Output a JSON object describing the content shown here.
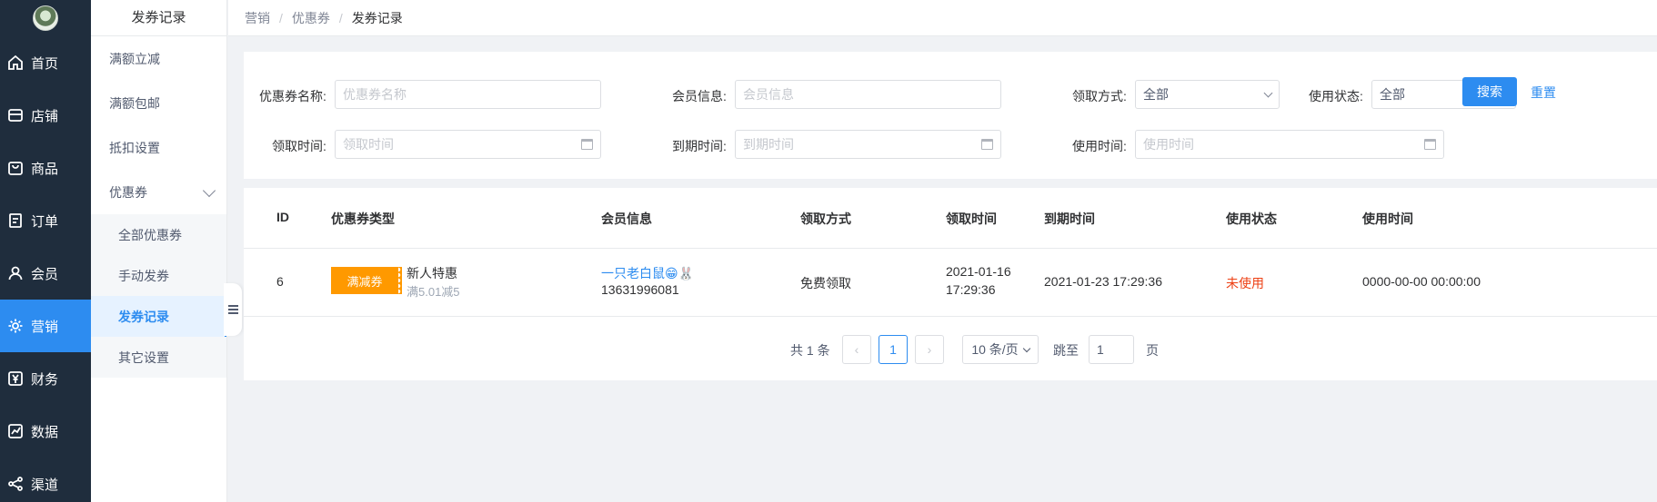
{
  "nav": {
    "items": [
      {
        "label": "首页",
        "icon": "home-icon"
      },
      {
        "label": "店铺",
        "icon": "store-icon"
      },
      {
        "label": "商品",
        "icon": "bag-icon"
      },
      {
        "label": "订单",
        "icon": "order-icon"
      },
      {
        "label": "会员",
        "icon": "user-icon"
      },
      {
        "label": "营销",
        "icon": "gear-icon"
      },
      {
        "label": "财务",
        "icon": "yen-icon"
      },
      {
        "label": "数据",
        "icon": "chart-icon"
      },
      {
        "label": "渠道",
        "icon": "share-icon"
      }
    ]
  },
  "subnav": {
    "title": "发券记录",
    "items": [
      "满额立减",
      "满额包邮",
      "抵扣设置",
      "优惠券"
    ],
    "children": [
      "全部优惠券",
      "手动发券",
      "发券记录",
      "其它设置"
    ]
  },
  "breadcrumb": [
    "营销",
    "优惠券",
    "发券记录"
  ],
  "filters": {
    "coupon_name_label": "优惠券名称:",
    "coupon_name_placeholder": "优惠券名称",
    "member_label": "会员信息:",
    "member_placeholder": "会员信息",
    "method_label": "领取方式:",
    "method_value": "全部",
    "status_label": "使用状态:",
    "status_value": "全部",
    "receive_time_label": "领取时间:",
    "receive_time_placeholder": "领取时间",
    "expire_time_label": "到期时间:",
    "expire_time_placeholder": "到期时间",
    "use_time_label": "使用时间:",
    "use_time_placeholder": "使用时间",
    "search_label": "搜索",
    "reset_label": "重置"
  },
  "table": {
    "columns": [
      "ID",
      "优惠券类型",
      "会员信息",
      "领取方式",
      "领取时间",
      "到期时间",
      "使用状态",
      "使用时间"
    ],
    "rows": [
      {
        "id": "6",
        "badge": "满减券",
        "coupon_name": "新人特惠",
        "coupon_rule": "满5.01减5",
        "member_name": "一只老白鼠😁🐰",
        "member_phone": "13631996081",
        "method": "免费领取",
        "receive_date": "2021-01-16",
        "receive_time": "17:29:36",
        "expire": "2021-01-23 17:29:36",
        "status": "未使用",
        "use_time": "0000-00-00 00:00:00"
      }
    ]
  },
  "pagination": {
    "total": "共 1 条",
    "current_page": "1",
    "page_size": "10 条/页",
    "jump_label": "跳至",
    "jump_value": "1",
    "page_unit": "页"
  },
  "colors": {
    "primary": "#2d8cf0",
    "sidebar": "#1f2d3d",
    "badge": "#ff9900",
    "status_unused": "#ed4014"
  }
}
